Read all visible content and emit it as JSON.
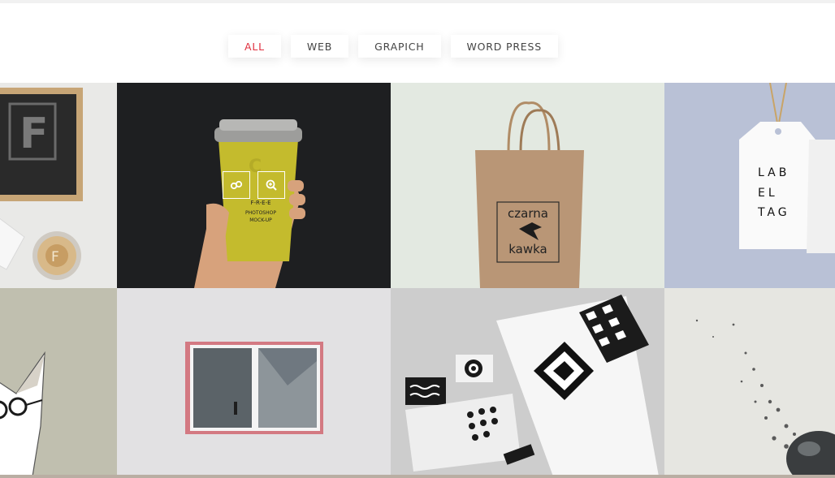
{
  "filters": {
    "items": [
      {
        "label": "ALL",
        "active": true
      },
      {
        "label": "WEB",
        "active": false
      },
      {
        "label": "GRAPICH",
        "active": false
      },
      {
        "label": "WORD PRESS",
        "active": false
      }
    ]
  },
  "portfolio": {
    "cup_mockup": {
      "cup_lines": [
        "F-R-E-E",
        "PHOTOSHOP",
        "MOCK-UP"
      ],
      "link_icon": "link-icon",
      "zoom_icon": "zoom-in-icon"
    },
    "bag_mockup": {
      "logo_top": "czarna",
      "logo_bottom": "kawka"
    },
    "tag_mockup": {
      "tag_lines": [
        "LAB",
        "EL",
        "TAG"
      ]
    }
  },
  "colors": {
    "accent": "#e0303f",
    "filter_text": "#444444"
  }
}
